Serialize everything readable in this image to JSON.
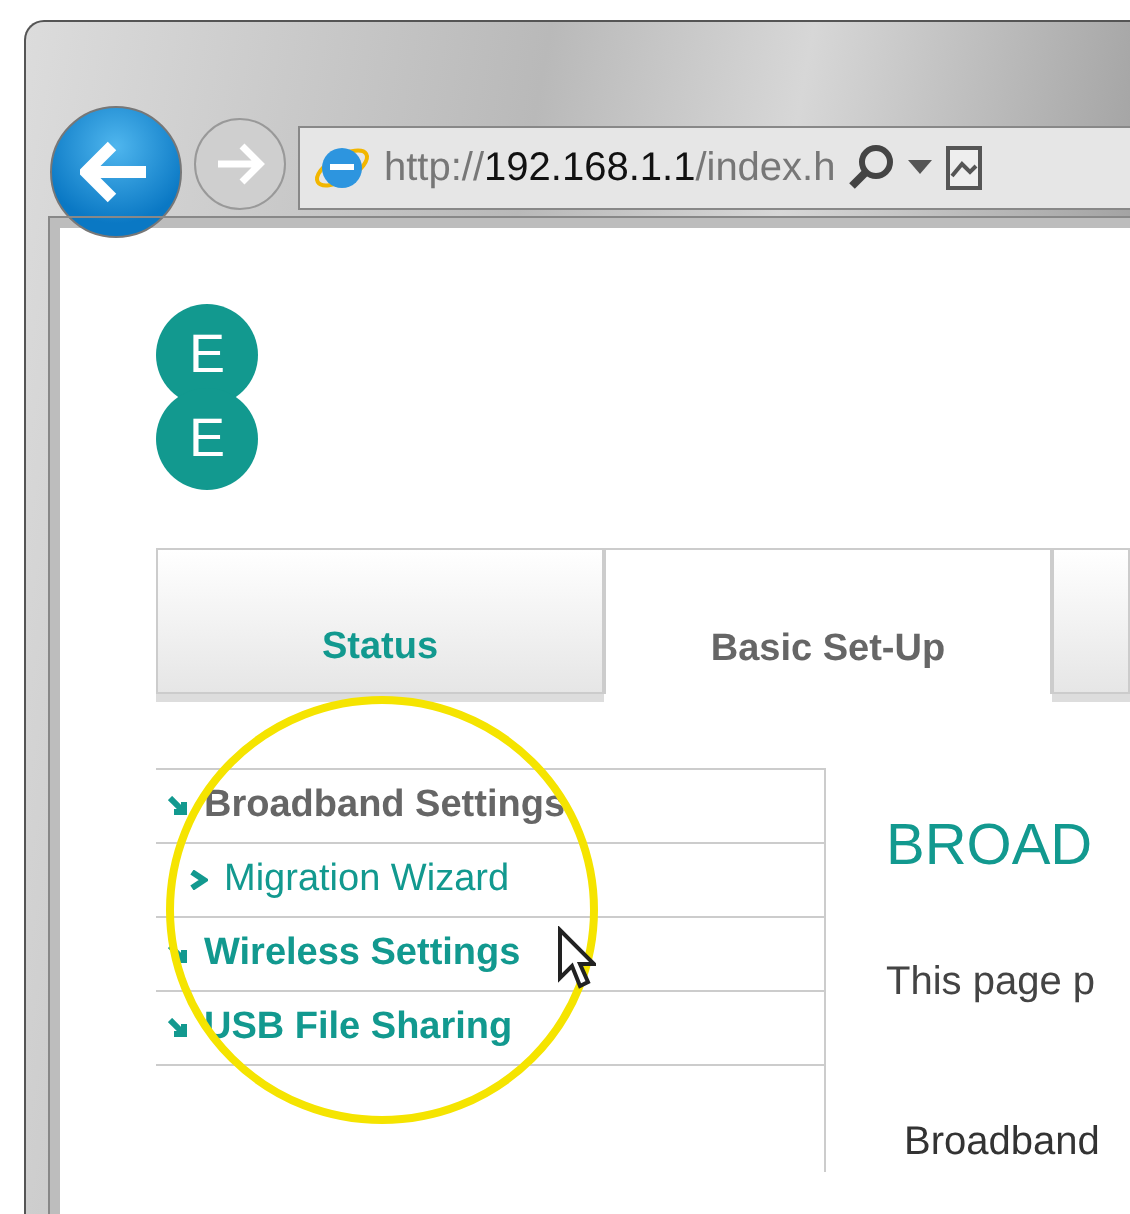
{
  "browser": {
    "address": {
      "prefix": "http://",
      "host": "192.168.1.1",
      "path": "/index.h"
    }
  },
  "logo": {
    "letters": [
      "E",
      "E"
    ]
  },
  "tabs": [
    {
      "label": "Status",
      "selected": false
    },
    {
      "label": "Basic Set-Up",
      "selected": true
    },
    {
      "selected": false
    }
  ],
  "sidebar": {
    "items": [
      {
        "label": "Broadband Settings",
        "kind": "section"
      },
      {
        "label": "Migration Wizard",
        "kind": "sub"
      },
      {
        "label": "Wireless Settings",
        "kind": "section"
      },
      {
        "label": "USB File Sharing",
        "kind": "section"
      }
    ]
  },
  "main": {
    "heading": "BROAD",
    "intro": "This page p",
    "field_label": "Broadband"
  }
}
